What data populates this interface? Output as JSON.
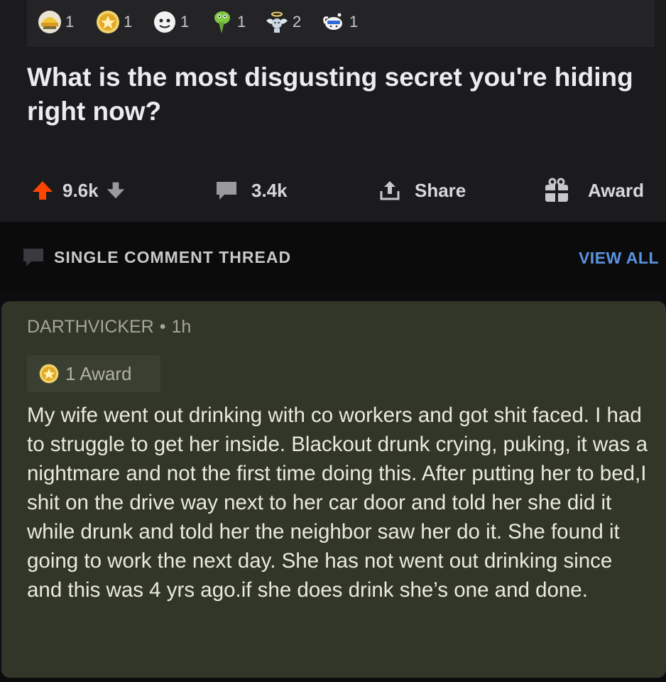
{
  "post": {
    "awards": [
      {
        "icon": "helmet-award-icon",
        "count": "1"
      },
      {
        "icon": "gold-award-icon",
        "count": "1"
      },
      {
        "icon": "face-award-icon",
        "count": "1"
      },
      {
        "icon": "green-creature-award-icon",
        "count": "1"
      },
      {
        "icon": "angel-award-icon",
        "count": "2"
      },
      {
        "icon": "snoo-award-icon",
        "count": "1"
      }
    ],
    "title": "What is the most disgusting secret you're hiding right now?",
    "actions": {
      "upvotes": "9.6k",
      "comments": "3.4k",
      "share": "Share",
      "award": "Award"
    }
  },
  "thread": {
    "label": "SINGLE COMMENT THREAD",
    "view_all": "VIEW ALL"
  },
  "comment": {
    "author": "DARTHVICKER",
    "separator": "•",
    "age": "1h",
    "award_label": "1 Award",
    "body": "My wife went out drinking with co workers and got shit faced. I had to struggle to get her inside. Blackout drunk crying, puking, it was a nightmare and not the first time doing this. After putting her to bed,I shit on the drive way next to her car door and told her she did it while drunk and told her the neighbor saw her do it. She found it going to work the next day. She has not went out drinking since and this was 4 yrs ago.if she does drink she’s one and done."
  },
  "colors": {
    "upvote": "#ff4500",
    "link": "#5a93e0",
    "comment_bg": "#323629",
    "gold": "#e8b62c"
  }
}
